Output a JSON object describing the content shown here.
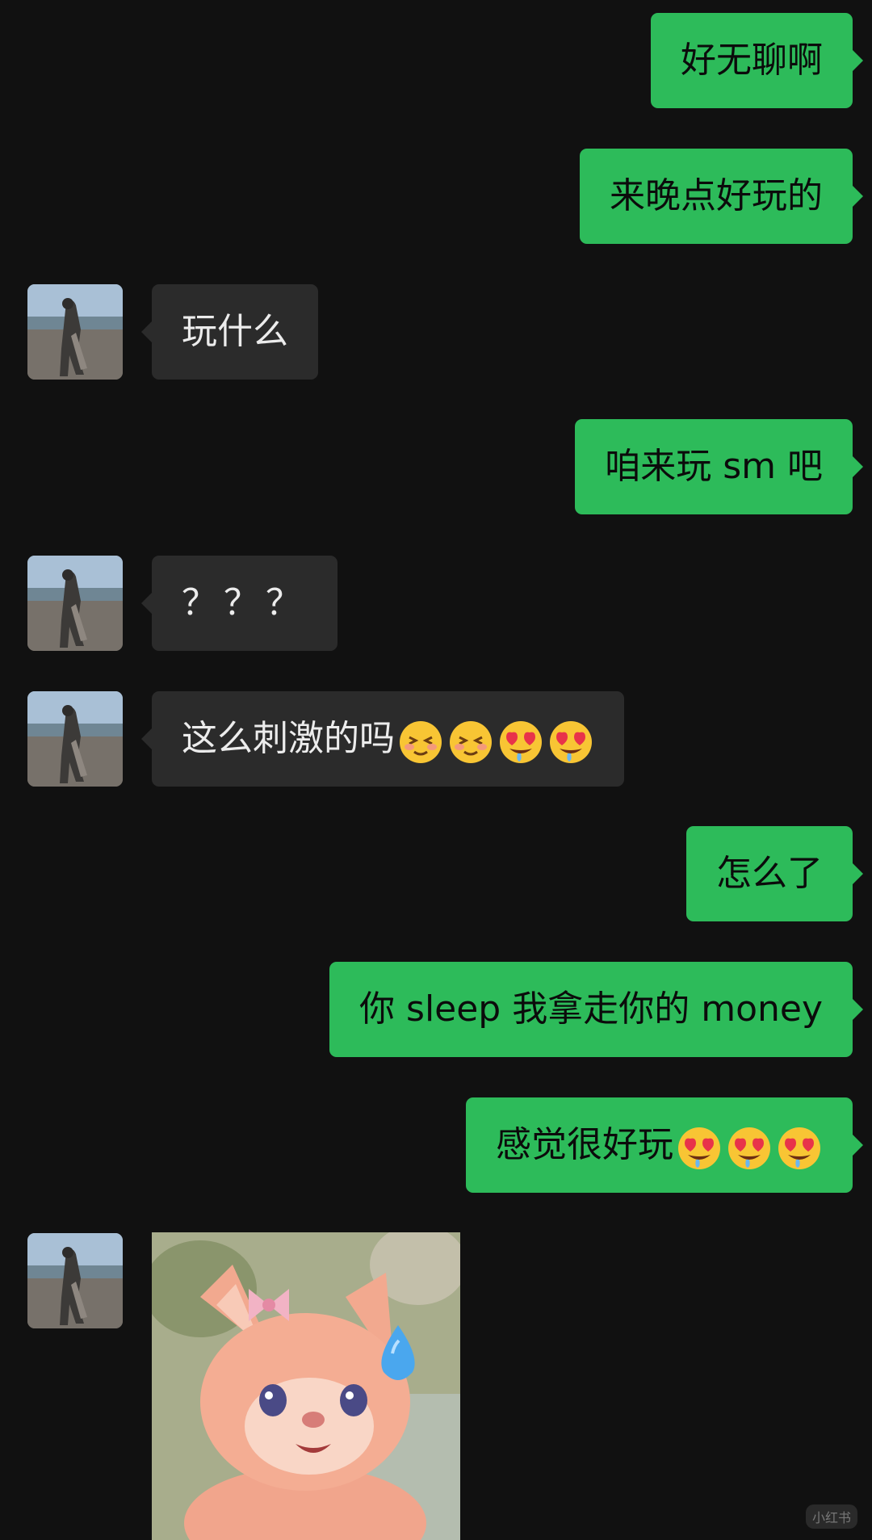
{
  "chat": {
    "messages": [
      {
        "sender": "me",
        "text": "好无聊啊"
      },
      {
        "sender": "me",
        "text": "来晚点好玩的"
      },
      {
        "sender": "contact",
        "text": "玩什么"
      },
      {
        "sender": "me",
        "text": "咱来玩 sm 吧"
      },
      {
        "sender": "contact",
        "text": "？？？"
      },
      {
        "sender": "contact",
        "text": "这么刺激的吗",
        "emojis": [
          "blushing-squint-face",
          "blushing-squint-face",
          "heart-eyes-drooling-face",
          "heart-eyes-drooling-face"
        ]
      },
      {
        "sender": "me",
        "text": "怎么了"
      },
      {
        "sender": "me",
        "text": "你 sleep 我拿走你的 money"
      },
      {
        "sender": "me",
        "text": "感觉很好玩",
        "emojis": [
          "heart-eyes-drooling-face",
          "heart-eyes-drooling-face",
          "heart-eyes-drooling-face"
        ]
      },
      {
        "sender": "contact",
        "type": "sticker",
        "sticker": "pink-plush-fox-sweat-drop"
      }
    ]
  },
  "colors": {
    "background": "#111111",
    "outgoing_bubble": "#2dbb5a",
    "incoming_bubble": "#2b2b2b",
    "incoming_text": "#ececec",
    "outgoing_text": "#0b0b0b"
  },
  "contact_avatar_icon": "person-on-beach-avatar",
  "watermark": "小红书"
}
